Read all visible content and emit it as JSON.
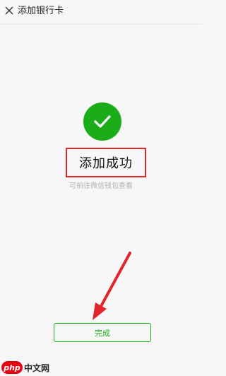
{
  "header": {
    "title": "添加银行卡",
    "close_icon": "close-icon"
  },
  "result": {
    "icon": "checkmark-icon",
    "title": "添加成功",
    "hint": "可前往微信钱包查看"
  },
  "actions": {
    "done_label": "完成"
  },
  "watermark": {
    "badge": "php",
    "text": "中文网"
  },
  "colors": {
    "brand_green": "#1aad19",
    "annotation_red": "#e0262b",
    "background": "#f7f7f7"
  }
}
